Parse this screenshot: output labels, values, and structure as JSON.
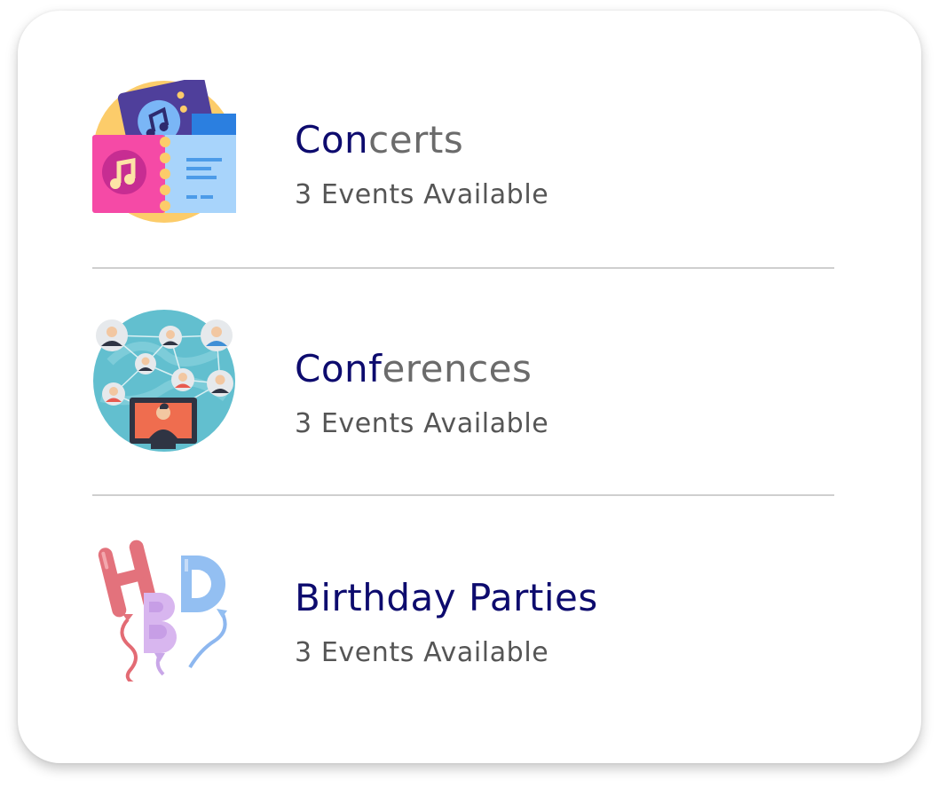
{
  "categories": [
    {
      "title_highlight": "Con",
      "title_rest": "certs",
      "subtitle": "3 Events Available",
      "icon": "concert-ticket-icon"
    },
    {
      "title_highlight": "Conf",
      "title_rest": "erences",
      "subtitle": "3 Events Available",
      "icon": "conference-network-icon"
    },
    {
      "title": "Birthday Parties",
      "subtitle": "3 Events Available",
      "icon": "hbd-balloons-icon"
    }
  ],
  "colors": {
    "title_highlight": "#0d0b6e",
    "title_rest": "#6b6b6b",
    "subtitle": "#555555",
    "divider": "#cfcfcf"
  }
}
